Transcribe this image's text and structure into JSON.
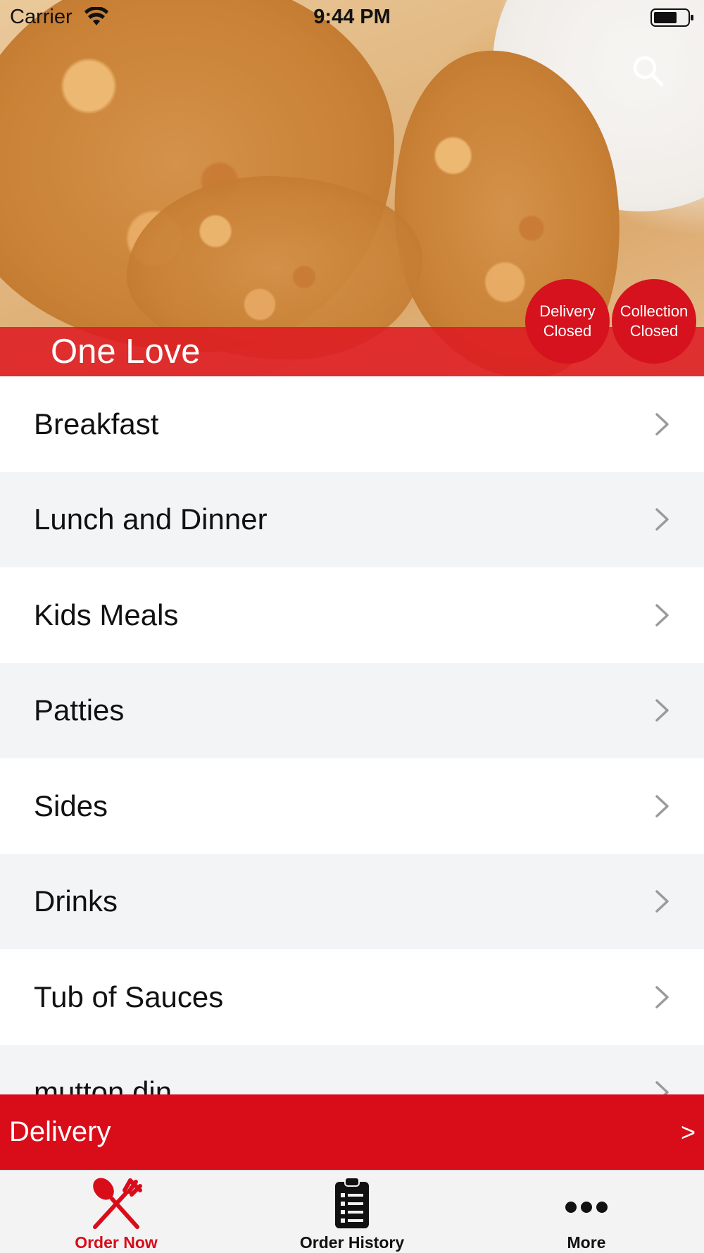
{
  "status_bar": {
    "carrier": "Carrier",
    "time": "9:44 PM"
  },
  "header": {
    "restaurant_name": "One Love",
    "delivery_status": [
      "Delivery",
      "Closed"
    ],
    "collection_status": [
      "Collection",
      "Closed"
    ],
    "accent_color": "#d90d1a"
  },
  "menu": {
    "items": [
      {
        "label": "Breakfast"
      },
      {
        "label": "Lunch and Dinner"
      },
      {
        "label": "Kids Meals"
      },
      {
        "label": "Patties"
      },
      {
        "label": "Sides"
      },
      {
        "label": "Drinks"
      },
      {
        "label": "Tub of Sauces"
      },
      {
        "label": "mutton din"
      }
    ]
  },
  "order_bar": {
    "mode_label": "Delivery",
    "arrow": ">"
  },
  "tab_bar": {
    "tabs": [
      {
        "label": "Order Now",
        "icon": "fork-knife-icon",
        "active": true
      },
      {
        "label": "Order History",
        "icon": "clipboard-icon",
        "active": false
      },
      {
        "label": "More",
        "icon": "more-dots-icon",
        "active": false
      }
    ]
  }
}
